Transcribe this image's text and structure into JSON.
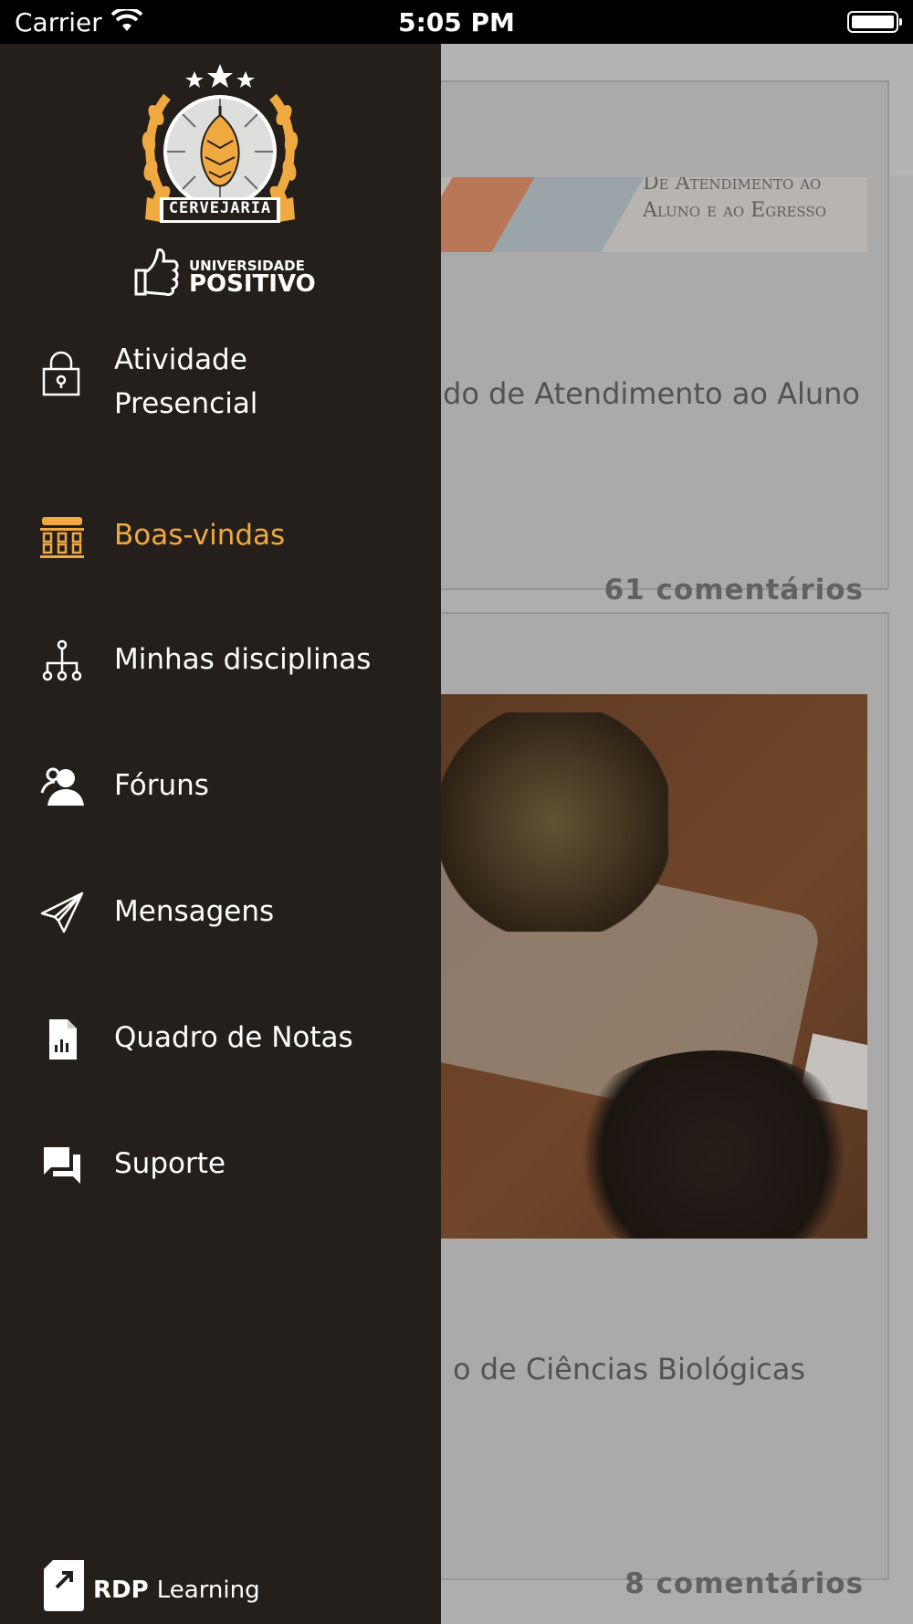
{
  "status_bar": {
    "carrier": "Carrier",
    "time": "5:05 PM"
  },
  "logo": {
    "brand_text": "CERVEJARIA",
    "university_line1": "UNIVERSIDADE",
    "university_line2": "POSITIVO"
  },
  "drawer": {
    "items": [
      {
        "label_line1": "Atividade",
        "label_line2": "Presencial",
        "icon": "lock-icon",
        "active": false
      },
      {
        "label": "Boas-vindas",
        "icon": "institution-icon",
        "active": true
      },
      {
        "label": "Minhas disciplinas",
        "icon": "hierarchy-icon",
        "active": false
      },
      {
        "label": "Fóruns",
        "icon": "users-icon",
        "active": false
      },
      {
        "label": "Mensagens",
        "icon": "paper-plane-icon",
        "active": false
      },
      {
        "label": "Quadro de Notas",
        "icon": "report-document-icon",
        "active": false
      },
      {
        "label": "Suporte",
        "icon": "chat-bubbles-icon",
        "active": false
      }
    ],
    "active_color": "#f0a941",
    "background": "#241f1a",
    "footer": {
      "brand": "RDP",
      "brand_suffix": "Learning"
    }
  },
  "background_content": {
    "cards": [
      {
        "banner_text_line1": "De Atendimento ao",
        "banner_text_line2": "Aluno e ao Egresso",
        "title": "do de Atendimento ao Aluno",
        "comments": "61 comentários"
      },
      {
        "title": "o de Ciências Biológicas",
        "comments": "8 comentários"
      }
    ]
  }
}
